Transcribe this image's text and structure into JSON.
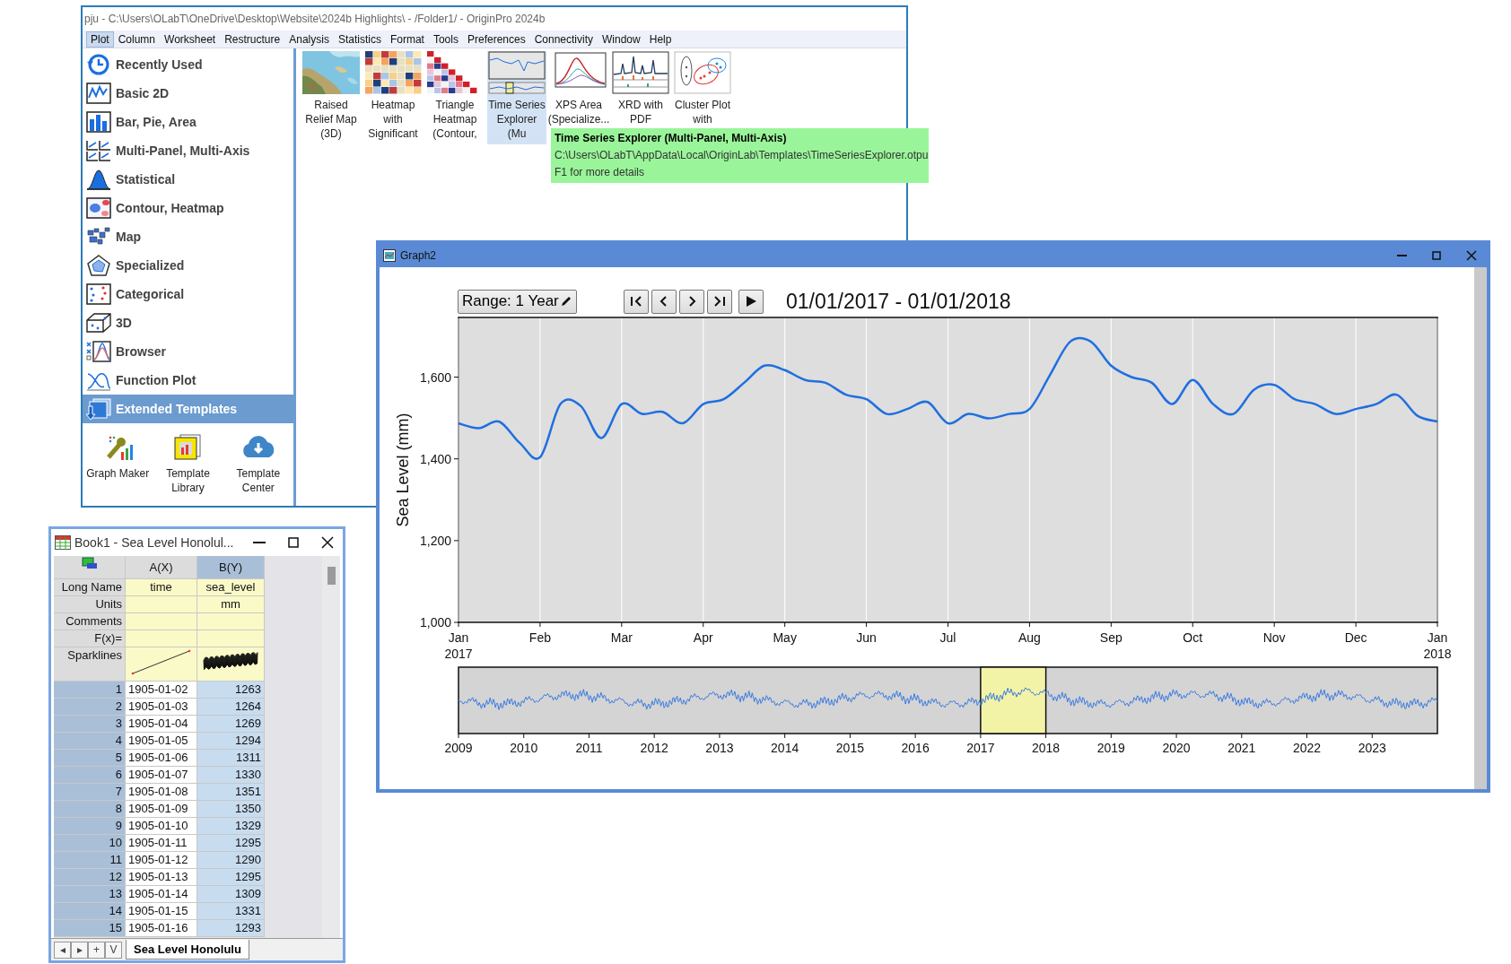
{
  "main_window": {
    "title": "pju - C:\\Users\\OLabT\\OneDrive\\Desktop\\Website\\2024b Highlights\\ - /Folder1/ - OriginPro 2024b",
    "menu": [
      {
        "label": "Plot",
        "selected": true
      },
      {
        "label": "Column",
        "selected": false
      },
      {
        "label": "Worksheet",
        "selected": false
      },
      {
        "label": "Restructure",
        "selected": false
      },
      {
        "label": "Analysis",
        "selected": false
      },
      {
        "label": "Statistics",
        "selected": false
      },
      {
        "label": "Format",
        "selected": false
      },
      {
        "label": "Tools",
        "selected": false
      },
      {
        "label": "Preferences",
        "selected": false
      },
      {
        "label": "Connectivity",
        "selected": false
      },
      {
        "label": "Window",
        "selected": false
      },
      {
        "label": "Help",
        "selected": false
      }
    ],
    "sidebar": {
      "items": [
        {
          "label": "Recently Used",
          "selected": false
        },
        {
          "label": "Basic 2D",
          "selected": false
        },
        {
          "label": "Bar, Pie, Area",
          "selected": false
        },
        {
          "label": "Multi-Panel, Multi-Axis",
          "selected": false
        },
        {
          "label": "Statistical",
          "selected": false
        },
        {
          "label": "Contour, Heatmap",
          "selected": false
        },
        {
          "label": "Map",
          "selected": false
        },
        {
          "label": "Specialized",
          "selected": false
        },
        {
          "label": "Categorical",
          "selected": false
        },
        {
          "label": "3D",
          "selected": false
        },
        {
          "label": "Browser",
          "selected": false
        },
        {
          "label": "Function Plot",
          "selected": false
        },
        {
          "label": "Extended Templates",
          "selected": true
        }
      ],
      "tools": [
        "Graph Maker",
        "Template Library",
        "Template Center"
      ]
    },
    "gallery": [
      {
        "label": "Raised Relief Map (3D)",
        "kind": "picture",
        "selected": false
      },
      {
        "label": "Heatmap with Significant",
        "kind": "chart",
        "selected": false
      },
      {
        "label": "Triangle Heatmap (Contour,",
        "kind": "chart",
        "selected": false
      },
      {
        "label": "Time Series Explorer (Mu",
        "kind": "chart",
        "selected": true
      },
      {
        "label": "XPS Area (Specialize...",
        "kind": "chart",
        "selected": false
      },
      {
        "label": "XRD with PDF",
        "kind": "chart",
        "selected": false
      },
      {
        "label": "Cluster Plot with",
        "kind": "chart",
        "selected": false
      }
    ],
    "tooltip": {
      "title": "Time Series Explorer (Multi-Panel, Multi-Axis)",
      "path": "C:\\Users\\OLabT\\AppData\\Local\\OriginLab\\Templates\\TimeSeriesExplorer.otpu",
      "hint": "F1 for more details"
    }
  },
  "graph_window": {
    "title": "Graph2",
    "range_button": "Range: 1 Year",
    "date_range": "01/01/2017 - 01/01/2018",
    "chart_data": {
      "type": "line",
      "grid": true,
      "ylabel": "Sea Level (mm)",
      "ylim": [
        1000,
        1746
      ],
      "categories": [
        "Jan\n2017",
        null,
        null,
        null,
        "Feb",
        null,
        null,
        null,
        "Mar",
        null,
        null,
        null,
        "Apr",
        null,
        null,
        null,
        "May",
        null,
        null,
        null,
        "Jun",
        null,
        null,
        null,
        "Jul",
        null,
        null,
        null,
        "Aug",
        null,
        null,
        null,
        "Sep",
        null,
        null,
        null,
        "Oct",
        null,
        null,
        null,
        "Nov",
        null,
        null,
        null,
        "Dec",
        null,
        null,
        null,
        "Jan\n2018"
      ],
      "yticks": [
        {
          "value": 1000,
          "label": "1,000"
        },
        {
          "value": 1200,
          "label": "1,200"
        },
        {
          "value": 1400,
          "label": "1,400"
        },
        {
          "value": 1600,
          "label": "1,600"
        }
      ],
      "values": [
        1487,
        1475,
        1491,
        1439,
        1404,
        1534,
        1529,
        1451,
        1534,
        1510,
        1515,
        1487,
        1534,
        1546,
        1586,
        1628,
        1617,
        1593,
        1586,
        1557,
        1546,
        1510,
        1522,
        1539,
        1487,
        1510,
        1499,
        1510,
        1522,
        1605,
        1687,
        1687,
        1628,
        1600,
        1586,
        1534,
        1593,
        1534,
        1510,
        1569,
        1581,
        1546,
        1534,
        1510,
        1522,
        1534,
        1557,
        1506,
        1491
      ]
    },
    "overview": {
      "ticks": [
        {
          "label": "2009",
          "selected": false
        },
        {
          "label": "2010",
          "selected": false
        },
        {
          "label": "2011",
          "selected": false
        },
        {
          "label": "2012",
          "selected": false
        },
        {
          "label": "2013",
          "selected": false
        },
        {
          "label": "2014",
          "selected": false
        },
        {
          "label": "2015",
          "selected": false
        },
        {
          "label": "2016",
          "selected": false
        },
        {
          "label": "2017",
          "selected": true
        },
        {
          "label": "2018",
          "selected": false
        },
        {
          "label": "2019",
          "selected": false
        },
        {
          "label": "2020",
          "selected": false
        },
        {
          "label": "2021",
          "selected": false
        },
        {
          "label": "2022",
          "selected": false
        },
        {
          "label": "2023",
          "selected": false
        }
      ]
    }
  },
  "workbook": {
    "title": "Book1 - Sea Level Honolul...",
    "columns": [
      {
        "label": "A(X)",
        "selected": false
      },
      {
        "label": "B(Y)",
        "selected": true
      }
    ],
    "label_rows": [
      {
        "label": "Long Name",
        "kind": "text",
        "cells": [
          "time",
          "sea_level"
        ]
      },
      {
        "label": "Units",
        "kind": "text",
        "cells": [
          null,
          "mm"
        ]
      },
      {
        "label": "Comments",
        "kind": "text"
      },
      {
        "label": "F(x)=",
        "kind": "text"
      },
      {
        "label": "Sparklines",
        "kind": "sparkline"
      }
    ],
    "rows": [
      {
        "number": "1",
        "cells": [
          "1905-01-02",
          "1263"
        ]
      },
      {
        "number": "2",
        "cells": [
          "1905-01-03",
          "1264"
        ]
      },
      {
        "number": "3",
        "cells": [
          "1905-01-04",
          "1269"
        ]
      },
      {
        "number": "4",
        "cells": [
          "1905-01-05",
          "1294"
        ]
      },
      {
        "number": "5",
        "cells": [
          "1905-01-06",
          "1311"
        ]
      },
      {
        "number": "6",
        "cells": [
          "1905-01-07",
          "1330"
        ]
      },
      {
        "number": "7",
        "cells": [
          "1905-01-08",
          "1351"
        ]
      },
      {
        "number": "8",
        "cells": [
          "1905-01-09",
          "1350"
        ]
      },
      {
        "number": "9",
        "cells": [
          "1905-01-10",
          "1329"
        ]
      },
      {
        "number": "10",
        "cells": [
          "1905-01-11",
          "1295"
        ]
      },
      {
        "number": "11",
        "cells": [
          "1905-01-12",
          "1290"
        ]
      },
      {
        "number": "12",
        "cells": [
          "1905-01-13",
          "1295"
        ]
      },
      {
        "number": "13",
        "cells": [
          "1905-01-14",
          "1309"
        ]
      },
      {
        "number": "14",
        "cells": [
          "1905-01-15",
          "1331"
        ]
      },
      {
        "number": "15",
        "cells": [
          "1905-01-16",
          "1293"
        ]
      }
    ],
    "sheet_nav": [
      "◂",
      "▸",
      "+",
      "V"
    ],
    "sheet_tab": "Sea Level Honolulu"
  }
}
